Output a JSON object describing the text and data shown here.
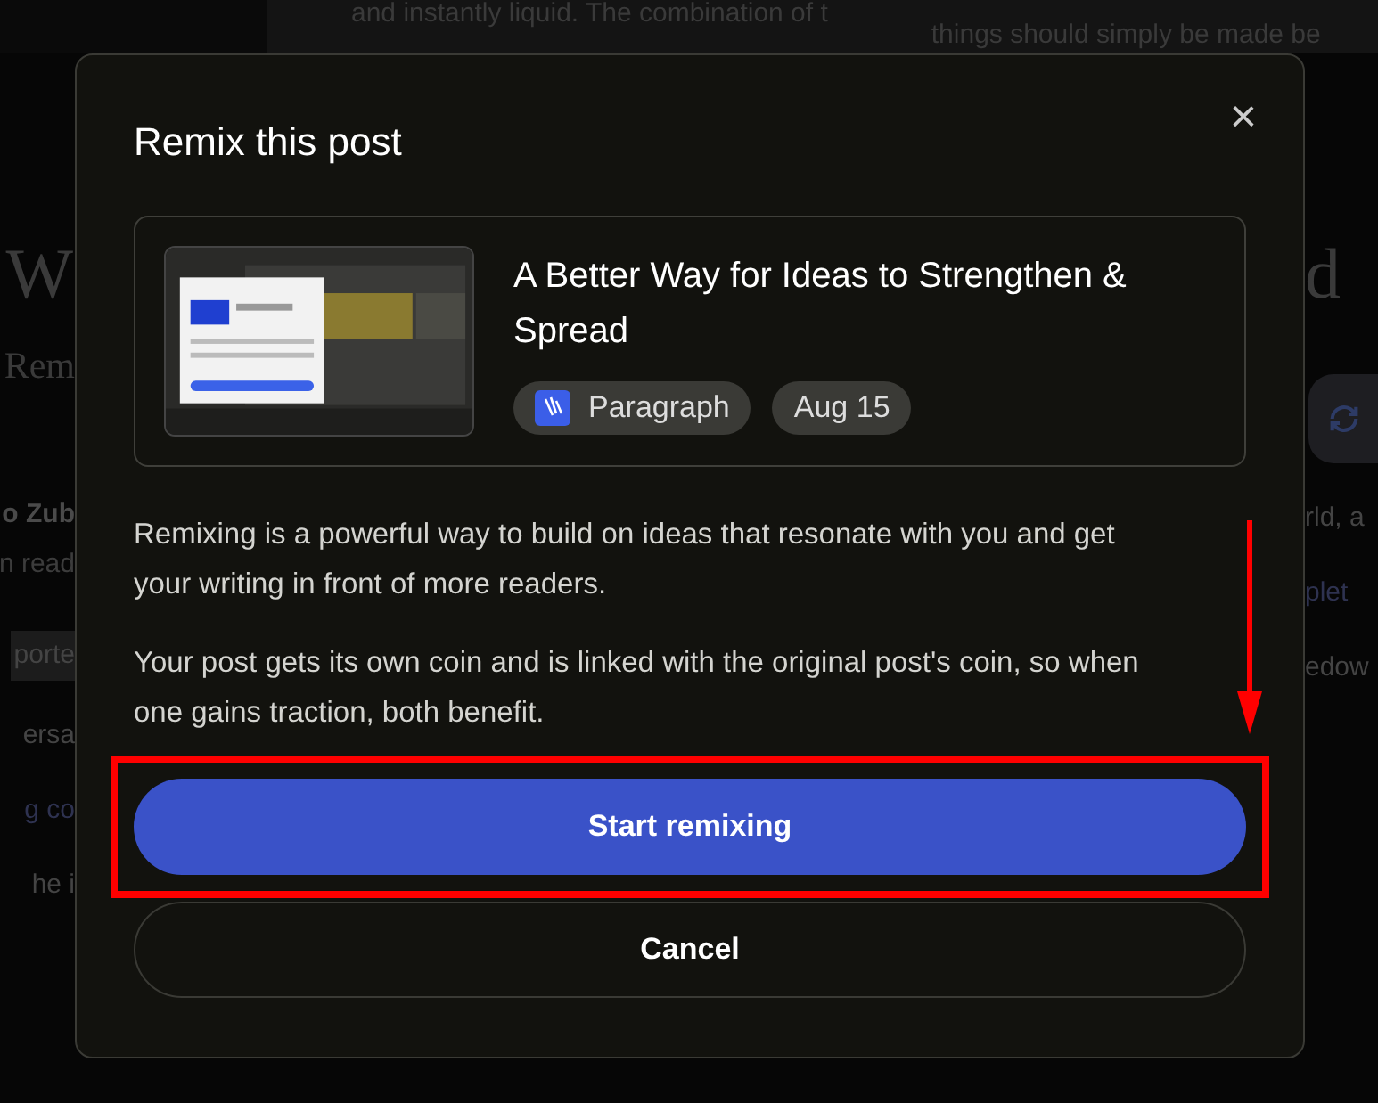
{
  "background": {
    "top_left": "and instantly liquid. The combination of t",
    "top_right": "things should simply be made be",
    "left": [
      {
        "kind": "heading",
        "text": "W"
      },
      {
        "kind": "subtitle",
        "text": "Rem"
      },
      {
        "kind": "author",
        "text": "o Zub"
      },
      {
        "kind": "meta",
        "text": "n read"
      },
      {
        "kind": "chip",
        "text": "porte"
      },
      {
        "kind": "body",
        "text": "ersa"
      },
      {
        "kind": "link",
        "text": "g co"
      },
      {
        "kind": "body",
        "text": "he i"
      }
    ],
    "right": [
      {
        "kind": "heading",
        "text": "d"
      },
      {
        "kind": "icon_button"
      },
      {
        "kind": "body",
        "text": "rld, a"
      },
      {
        "kind": "link",
        "text": "plet"
      },
      {
        "kind": "body",
        "text": "edow"
      }
    ]
  },
  "modal": {
    "title": "Remix this post",
    "close": "×",
    "post": {
      "title": "A Better Way for Ideas to Strengthen & Spread",
      "publisher": "Paragraph",
      "date": "Aug 15"
    },
    "paragraphs": [
      "Remixing is a powerful way to build on ideas that resonate with you and get your writing in front of more readers.",
      "Your post gets its own coin and is linked with the original post's coin, so when one gains traction, both benefit."
    ],
    "buttons": [
      {
        "label": "Start remixing",
        "kind": "primary",
        "highlighted": true
      },
      {
        "label": "Cancel",
        "kind": "secondary",
        "highlighted": false
      }
    ]
  }
}
